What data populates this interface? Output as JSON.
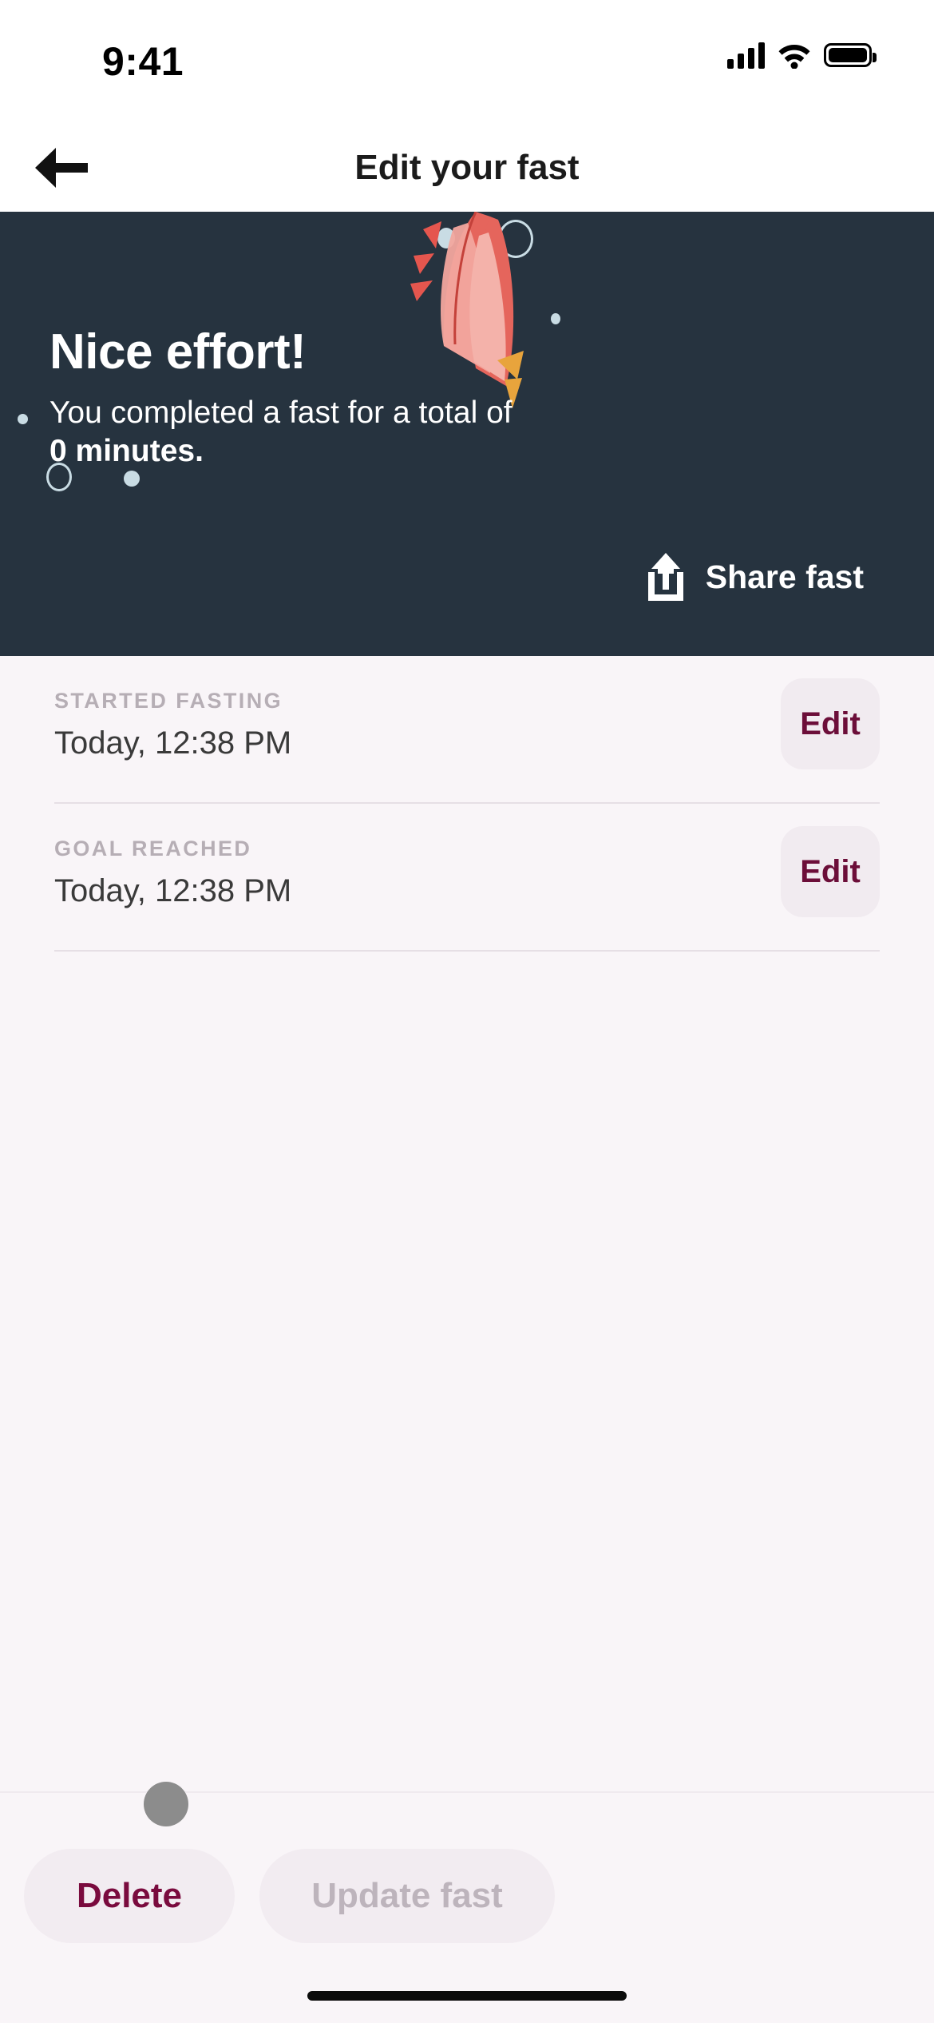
{
  "status_bar": {
    "time": "9:41",
    "signal_icon": "cellular-signal-icon",
    "wifi_icon": "wifi-icon",
    "battery_icon": "battery-icon"
  },
  "nav": {
    "back_icon": "arrow-left-icon",
    "title": "Edit your fast"
  },
  "hero": {
    "background_color": "#26333F",
    "title": "Nice effort!",
    "message_prefix": "You completed a fast for a total of ",
    "message_value": "0",
    "message_suffix": "minutes.",
    "share_label": "Share fast",
    "share_icon": "share-icon",
    "illustration": "party-popper-icon"
  },
  "list": {
    "rows": [
      {
        "label": "STARTED FASTING",
        "value": "Today, 12:38 PM",
        "action": "Edit"
      },
      {
        "label": "GOAL REACHED",
        "value": "Today, 12:38 PM",
        "action": "Edit"
      }
    ]
  },
  "bottom_bar": {
    "delete_label": "Delete",
    "update_label": "Update fast",
    "delete_color": "#7A0B3E",
    "update_color": "#BDB4BC"
  },
  "home_indicator": "home-indicator"
}
